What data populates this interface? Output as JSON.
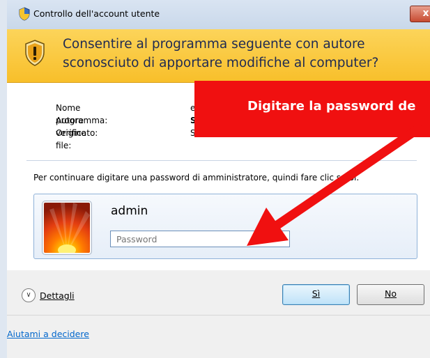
{
  "window": {
    "title": "Controllo dell'account utente",
    "close_label": "x"
  },
  "banner": {
    "line1": "Consentire al programma seguente con autore",
    "line2": "sconosciuto di apportare modifiche al computer?"
  },
  "details": [
    {
      "label": "Nome programma:",
      "value": "e"
    },
    {
      "label": "Autore verificato:",
      "value": "S"
    },
    {
      "label": "Origine file:",
      "value": "Scaricate da Internet"
    }
  ],
  "instruction": "Per continuare digitare una password di amministratore, quindi fare clic su Sì.",
  "credential": {
    "username": "admin",
    "password_placeholder": "Password",
    "password_value": ""
  },
  "footer": {
    "details_label": "Dettagli",
    "yes_label": "Sì",
    "no_label": "No",
    "help_link": "Aiutami a decidere"
  },
  "annotation": {
    "text": "Digitare la password de",
    "color": "#f01010"
  }
}
